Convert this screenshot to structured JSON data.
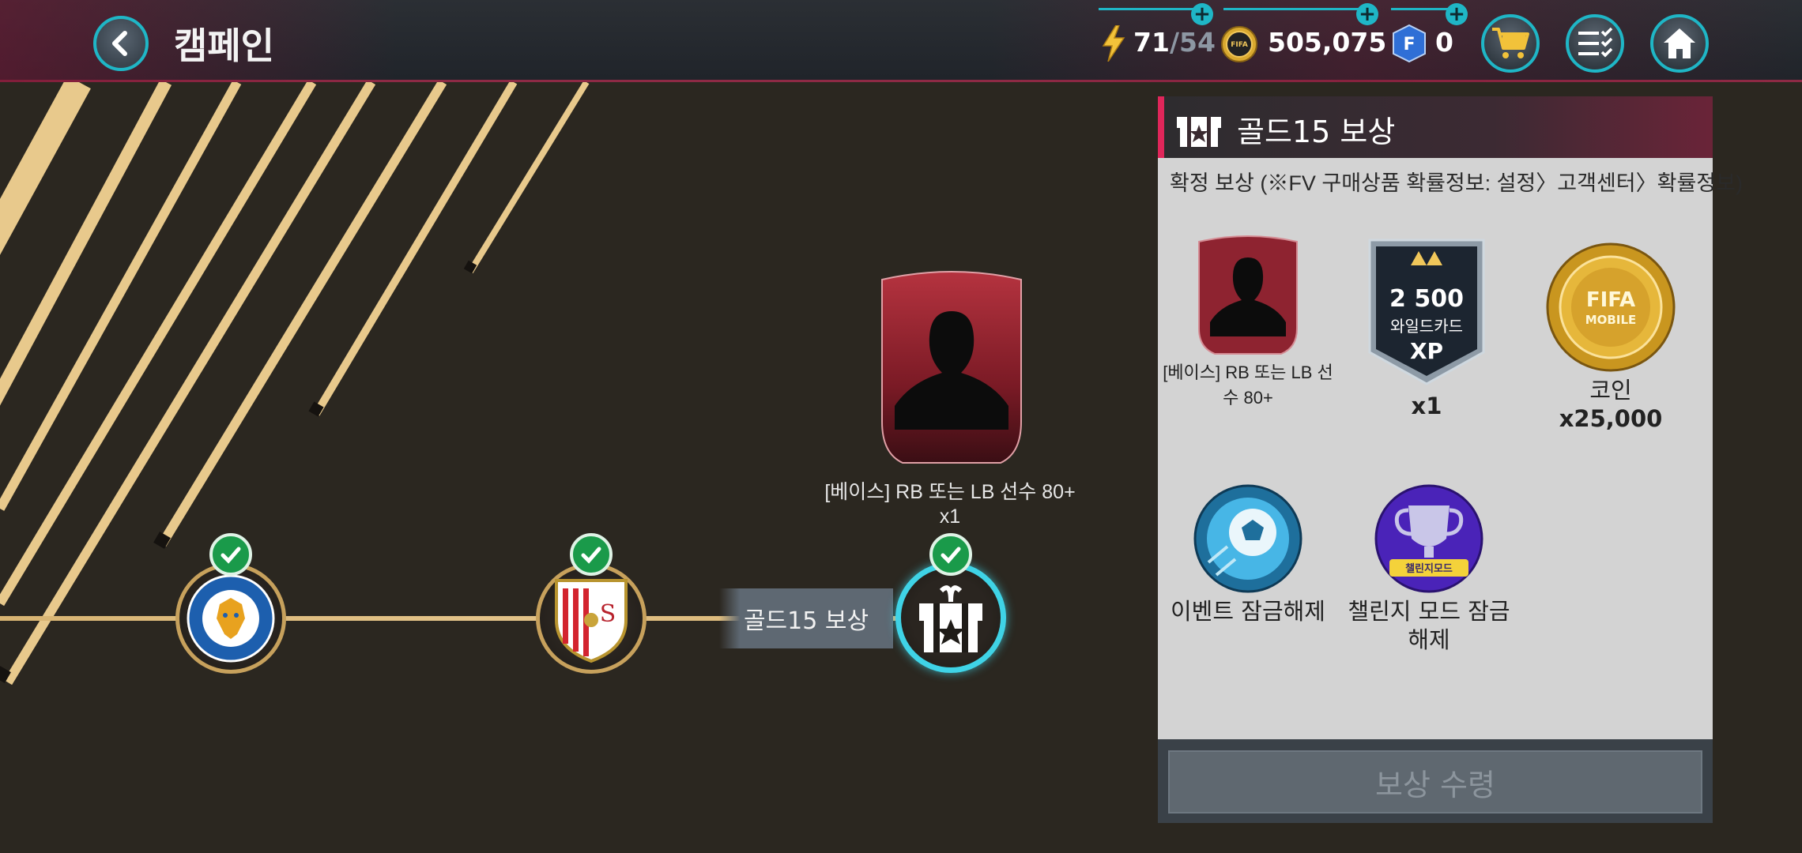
{
  "header": {
    "title": "캠페인",
    "energy_current": "71",
    "energy_max": "/54",
    "coins": "505,075",
    "fifa_points": "0",
    "plus": "+"
  },
  "stage": {
    "label": "골드15 보상",
    "card_name": "[베이스] RB 또는 LB 선수 80+",
    "card_qty": "x1"
  },
  "panel": {
    "title": "골드15 보상",
    "subtitle": "확정 보상 (※FV 구매상품 확률정보: 설정〉고객센터〉확률정보)",
    "items": [
      {
        "label": "[베이스] RB 또는 LB 선수 80+",
        "qty": ""
      },
      {
        "label": "",
        "qty": "x1",
        "xp_amount": "2 500",
        "xp_line": "와일드카드",
        "xp_tag": "XP"
      },
      {
        "label": "코인",
        "qty": "x25,000",
        "coin_text1": "FIFA",
        "coin_text2": "MOBILE"
      },
      {
        "label": "이벤트 잠금해제",
        "qty": ""
      },
      {
        "label": "챌린지 모드 잠금 해제",
        "qty": "",
        "banner": "챌린지모드"
      }
    ],
    "claim_button": "보상 수령"
  },
  "colors": {
    "accent": "#1fb6c6",
    "gold": "#d8b472",
    "panel_accent": "#e0265a",
    "check": "#1a9a4a"
  }
}
